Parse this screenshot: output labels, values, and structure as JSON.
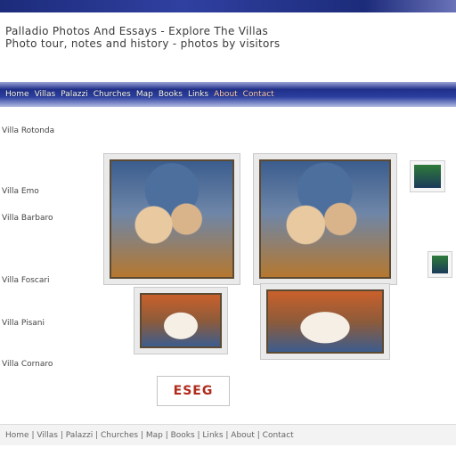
{
  "header": {
    "lines": [
      "Palladio Photos And Essays - Explore The Villas",
      "Photo tour, notes and history - photos by visitors"
    ]
  },
  "nav": {
    "links": [
      "Home",
      "Villas",
      "Palazzi",
      "Churches",
      "Map",
      "Books",
      "Links",
      "About",
      "Contact"
    ]
  },
  "sidebar": {
    "items": [
      "Villa Rotonda",
      "Villa Emo",
      "Villa Barbaro",
      "Villa Foscari",
      "Villa Pisani",
      "Villa Cornaro"
    ]
  },
  "footer": {
    "text": "Home | Villas | Palazzi | Churches | Map | Books | Links | About | Contact"
  },
  "logo": {
    "text": "ESEG"
  }
}
